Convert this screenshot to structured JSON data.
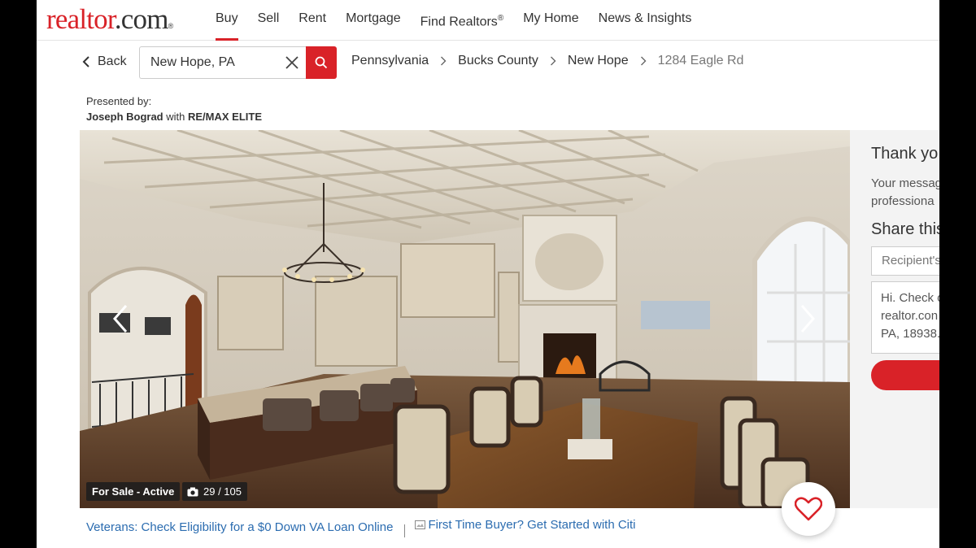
{
  "logo": {
    "part1": "realtor",
    "part2": ".com",
    "mark": "®"
  },
  "nav": {
    "items": [
      {
        "label": "Buy",
        "active": true
      },
      {
        "label": "Sell"
      },
      {
        "label": "Rent"
      },
      {
        "label": "Mortgage"
      },
      {
        "label": "Find Realtors",
        "sup": "®"
      },
      {
        "label": "My Home"
      },
      {
        "label": "News & Insights"
      }
    ]
  },
  "search": {
    "back_label": "Back",
    "value": "New Hope, PA"
  },
  "breadcrumb": [
    "Pennsylvania",
    "Bucks County",
    "New Hope",
    "1284 Eagle Rd"
  ],
  "presented": {
    "prefix": "Presented by:",
    "agent": "Joseph Bograd",
    "with": "with",
    "brokerage": "RE/MAX ELITE"
  },
  "gallery": {
    "status": "For Sale - Active",
    "photo_count": "29 / 105"
  },
  "panel": {
    "title": "Thank yo",
    "message_lines": [
      "Your messag",
      "professiona"
    ],
    "share_title": "Share this",
    "recipient_placeholder": "Recipient's",
    "textarea_lines": [
      "Hi. Check o",
      "realtor.con",
      "PA, 18938."
    ]
  },
  "promos": [
    "Veterans: Check Eligibility for a $0 Down VA Loan Online",
    "First Time Buyer? Get Started with Citi"
  ],
  "colors": {
    "brand_red": "#d92228",
    "link_blue": "#2b6cb0"
  }
}
